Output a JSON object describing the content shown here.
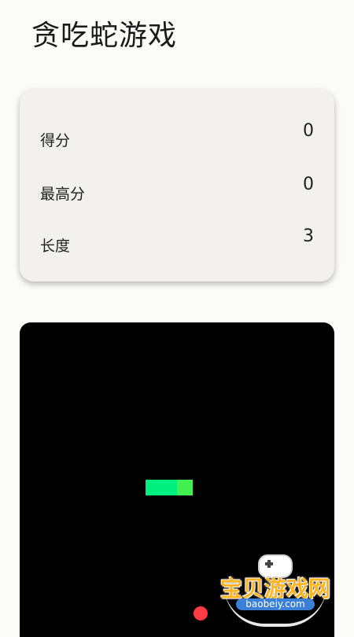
{
  "app": {
    "title": "贪吃蛇游戏"
  },
  "stats": [
    {
      "label": "得分",
      "value": "0"
    },
    {
      "label": "最高分",
      "value": "0"
    },
    {
      "label": "长度",
      "value": "3"
    }
  ],
  "board": {
    "snake_length": 3,
    "snake_colors": [
      "#00f07f",
      "#00f07f",
      "#44f04f"
    ],
    "food_color": "#ff3b44"
  },
  "watermark": {
    "text": "宝贝游戏网",
    "domain": "baobeiy.com"
  }
}
